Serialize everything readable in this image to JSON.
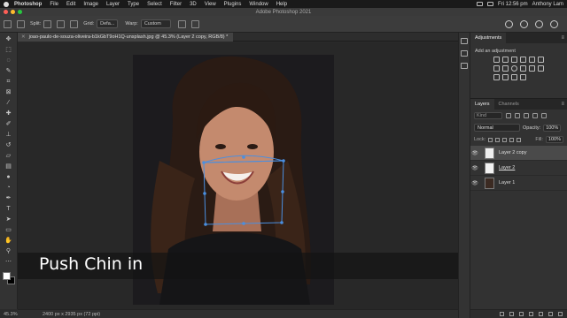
{
  "menubar": {
    "app": "Photoshop",
    "items": [
      "File",
      "Edit",
      "Image",
      "Layer",
      "Type",
      "Select",
      "Filter",
      "3D",
      "View",
      "Plugins",
      "Window",
      "Help"
    ],
    "clock": "Fri 12:56 pm",
    "user": "Anthony Lam"
  },
  "window": {
    "title": "Adobe Photoshop 2021"
  },
  "options": {
    "split_label": "Split:",
    "grid_label": "Grid:",
    "grid_value": "Defa...",
    "warp_label": "Warp:",
    "warp_value": "Custom"
  },
  "document": {
    "tab_title": "joao-paulo-de-souza-oliveira-b1kGbT9oH1Q-unsplash.jpg @ 45.3% (Layer 2 copy, RGB/8) *"
  },
  "canvas": {
    "caption": "Push Chin in"
  },
  "status": {
    "zoom": "45.3%",
    "dims": "2400 px x 2935 px (72 ppi)"
  },
  "adjustments": {
    "tab": "Adjustments",
    "subtitle": "Add an adjustment"
  },
  "layers_panel": {
    "tabs": [
      "Layers",
      "Channels"
    ],
    "kind": "Kind",
    "blend_mode": "Normal",
    "opacity_label": "Opacity:",
    "opacity_value": "100%",
    "lock_label": "Lock:",
    "fill_label": "Fill:",
    "fill_value": "100%",
    "layers": [
      {
        "name": "Layer 2 copy",
        "selected": true
      },
      {
        "name": "Layer 2",
        "selected": false
      },
      {
        "name": "Layer 1",
        "selected": false
      }
    ]
  },
  "colors": {
    "accent": "#3a7bd5",
    "panel": "#323232",
    "canvas": "#282828"
  }
}
